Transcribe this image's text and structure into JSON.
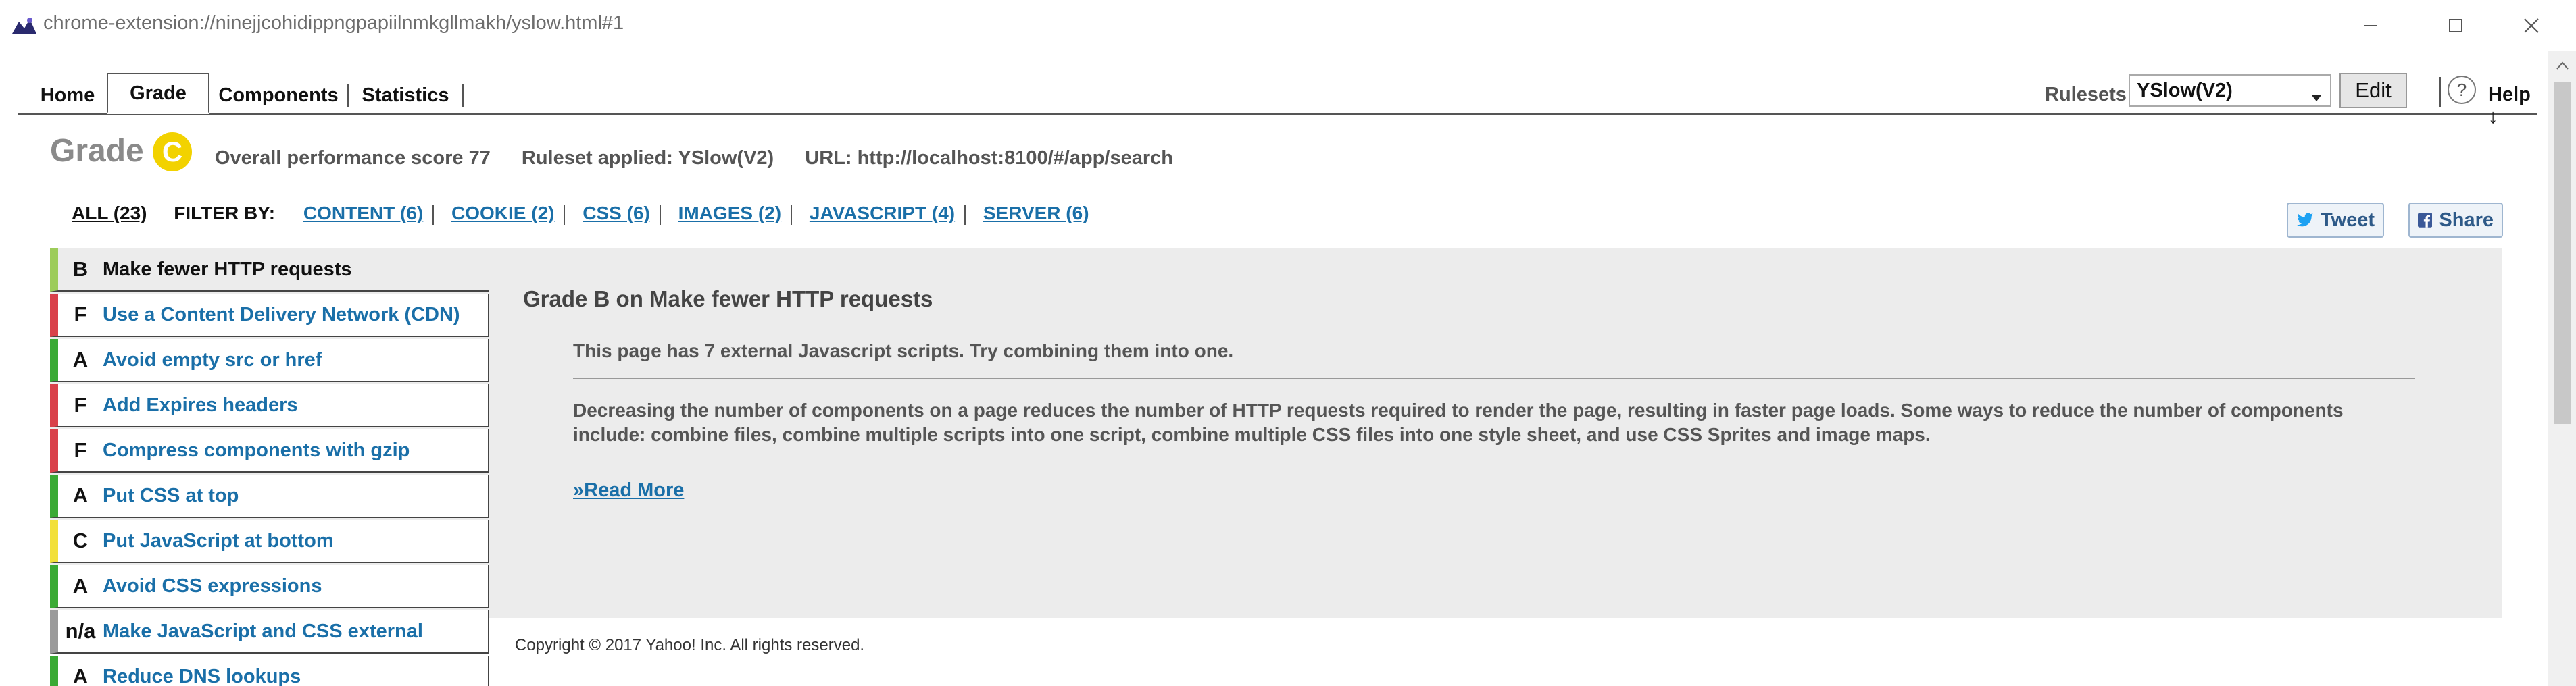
{
  "window": {
    "title": "chrome-extension://ninejjcohidippngpapiilnmkgllmakh/yslow.html#1"
  },
  "nav": {
    "tabs": [
      {
        "label": "Home",
        "active": false
      },
      {
        "label": "Grade",
        "active": true
      },
      {
        "label": "Components",
        "active": false
      },
      {
        "label": "Statistics",
        "active": false
      }
    ],
    "rulesets_label": "Rulesets",
    "ruleset_value": "YSlow(V2)",
    "edit_label": "Edit",
    "help_icon_text": "?",
    "help_label": "Help ↓"
  },
  "grade": {
    "word": "Grade",
    "letter": "C",
    "letter_color": "#f2d200",
    "overall": "Overall performance score 77",
    "ruleset": "Ruleset applied: YSlow(V2)",
    "url": "URL: http://localhost:8100/#/app/search"
  },
  "filter": {
    "all": "ALL (23)",
    "filter_by": "FILTER BY:",
    "items": [
      "CONTENT (6)",
      "COOKIE (2)",
      "CSS (6)",
      "IMAGES (2)",
      "JAVASCRIPT (4)",
      "SERVER (6)"
    ]
  },
  "social": {
    "tweet": "Tweet",
    "share": "Share"
  },
  "rules": [
    {
      "grade": "B",
      "title": "Make fewer HTTP requests",
      "color": "#9dcc5a",
      "selected": true
    },
    {
      "grade": "F",
      "title": "Use a Content Delivery Network (CDN)",
      "color": "#d9414a",
      "selected": false
    },
    {
      "grade": "A",
      "title": "Avoid empty src or href",
      "color": "#3aaa35",
      "selected": false
    },
    {
      "grade": "F",
      "title": "Add Expires headers",
      "color": "#d9414a",
      "selected": false
    },
    {
      "grade": "F",
      "title": "Compress components with gzip",
      "color": "#d9414a",
      "selected": false
    },
    {
      "grade": "A",
      "title": "Put CSS at top",
      "color": "#3aaa35",
      "selected": false
    },
    {
      "grade": "C",
      "title": "Put JavaScript at bottom",
      "color": "#f2e03a",
      "selected": false
    },
    {
      "grade": "A",
      "title": "Avoid CSS expressions",
      "color": "#3aaa35",
      "selected": false
    },
    {
      "grade": "n/a",
      "title": "Make JavaScript and CSS external",
      "color": "#9a9a9a",
      "selected": false
    },
    {
      "grade": "A",
      "title": "Reduce DNS lookups",
      "color": "#3aaa35",
      "selected": false
    }
  ],
  "detail": {
    "heading": "Grade B on Make fewer HTTP requests",
    "message": "This page has 7 external Javascript scripts. Try combining them into one.",
    "description": "Decreasing the number of components on a page reduces the number of HTTP requests required to render the page, resulting in faster page loads. Some ways to reduce the number of components include: combine files, combine multiple scripts into one script, combine multiple CSS files into one style sheet, and use CSS Sprites and image maps.",
    "read_more": "»Read More"
  },
  "footer": {
    "copyright": "Copyright © 2017 Yahoo! Inc. All rights reserved."
  }
}
